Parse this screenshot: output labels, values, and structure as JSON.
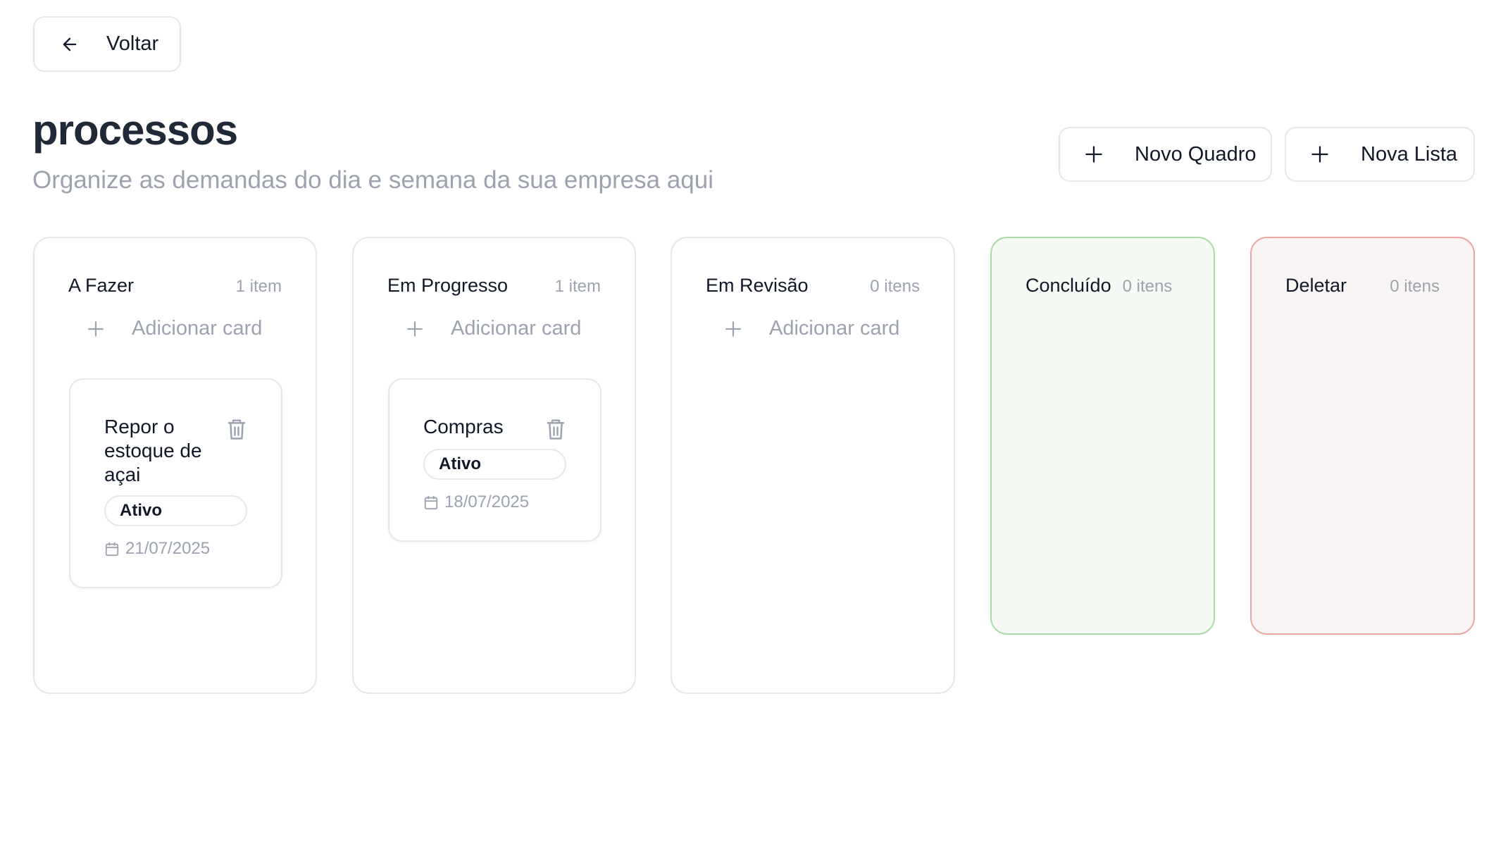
{
  "nav": {
    "back_label": "Voltar"
  },
  "header": {
    "title": "processos",
    "subtitle": "Organize as demandas do dia e semana da sua empresa aqui"
  },
  "actions": {
    "new_board": "Novo Quadro",
    "new_list": "Nova Lista"
  },
  "colors": {
    "done_border": "#a7dca6",
    "done_bg": "#f6faf5",
    "delete_border": "#eca5a1",
    "delete_bg": "#faf5f5"
  },
  "columns": [
    {
      "name": "A Fazer",
      "count": "1 item",
      "add_label": "Adicionar card",
      "cards": [
        {
          "title": "Repor o estoque de açai",
          "status": "Ativo",
          "date": "21/07/2025"
        }
      ]
    },
    {
      "name": "Em Progresso",
      "count": "1 item",
      "add_label": "Adicionar card",
      "cards": [
        {
          "title": "Compras",
          "status": "Ativo",
          "date": "18/07/2025"
        }
      ]
    },
    {
      "name": "Em Revisão",
      "count": "0 itens",
      "add_label": "Adicionar card",
      "cards": []
    },
    {
      "name": "Concluído",
      "count": "0 itens"
    },
    {
      "name": "Deletar",
      "count": "0 itens"
    }
  ]
}
